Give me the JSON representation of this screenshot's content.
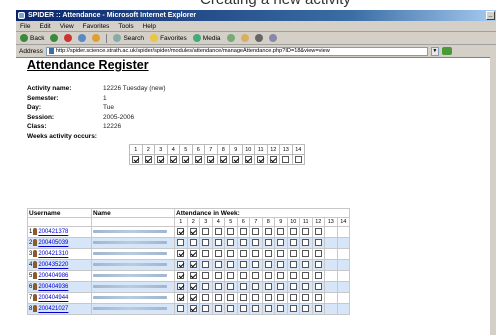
{
  "slide_title": "Creating a new activity",
  "browser": {
    "title": "SPIDER :: Attendance - Microsoft Internet Explorer",
    "menu": [
      "File",
      "Edit",
      "View",
      "Favorites",
      "Tools",
      "Help"
    ],
    "toolbar": {
      "back": "Back",
      "search": "Search",
      "favorites": "Favorites",
      "media": "Media"
    },
    "address_label": "Address",
    "url": "http://spider.science.strath.ac.uk/spider/spider/modules/attendance/manageAttendance.php?ID=18&view=view"
  },
  "page": {
    "title": "Attendance Register",
    "info": [
      {
        "label": "Activity name:",
        "value": "12226 Tuesday (new)"
      },
      {
        "label": "Semester:",
        "value": "1"
      },
      {
        "label": "Day:",
        "value": "Tue"
      },
      {
        "label": "Session:",
        "value": "2005-2006"
      },
      {
        "label": "Class:",
        "value": "12226"
      }
    ],
    "weeks_label": "Weeks activity occurs:",
    "weeks": [
      "1",
      "2",
      "3",
      "4",
      "5",
      "6",
      "7",
      "8",
      "9",
      "10",
      "11",
      "12",
      "13",
      "14"
    ],
    "weeks_checked": [
      true,
      true,
      true,
      true,
      true,
      true,
      true,
      true,
      true,
      true,
      true,
      true,
      false,
      false
    ],
    "register": {
      "col_username": "Username",
      "col_name": "Name",
      "col_attendance": "Attendance in Week:",
      "students": [
        {
          "num": "1",
          "username": "200421378",
          "marks": [
            true,
            true,
            false,
            false,
            false,
            false,
            false,
            false,
            false,
            false,
            false,
            false
          ]
        },
        {
          "num": "2",
          "username": "200405039",
          "marks": [
            false,
            false,
            false,
            false,
            false,
            false,
            false,
            false,
            false,
            false,
            false,
            false
          ]
        },
        {
          "num": "3",
          "username": "200421310",
          "marks": [
            true,
            true,
            false,
            false,
            false,
            false,
            false,
            false,
            false,
            false,
            false,
            false
          ]
        },
        {
          "num": "4",
          "username": "200435220",
          "marks": [
            true,
            true,
            false,
            false,
            false,
            false,
            false,
            false,
            false,
            false,
            false,
            false
          ]
        },
        {
          "num": "5",
          "username": "200404986",
          "marks": [
            true,
            true,
            false,
            false,
            false,
            false,
            false,
            false,
            false,
            false,
            false,
            false
          ]
        },
        {
          "num": "6",
          "username": "200404936",
          "marks": [
            true,
            true,
            false,
            false,
            false,
            false,
            false,
            false,
            false,
            false,
            false,
            false
          ]
        },
        {
          "num": "7",
          "username": "200404944",
          "marks": [
            true,
            true,
            false,
            false,
            false,
            false,
            false,
            false,
            false,
            false,
            false,
            false
          ]
        },
        {
          "num": "8",
          "username": "200421027",
          "marks": [
            false,
            true,
            false,
            false,
            false,
            false,
            false,
            false,
            false,
            false,
            false,
            false
          ]
        }
      ]
    }
  }
}
